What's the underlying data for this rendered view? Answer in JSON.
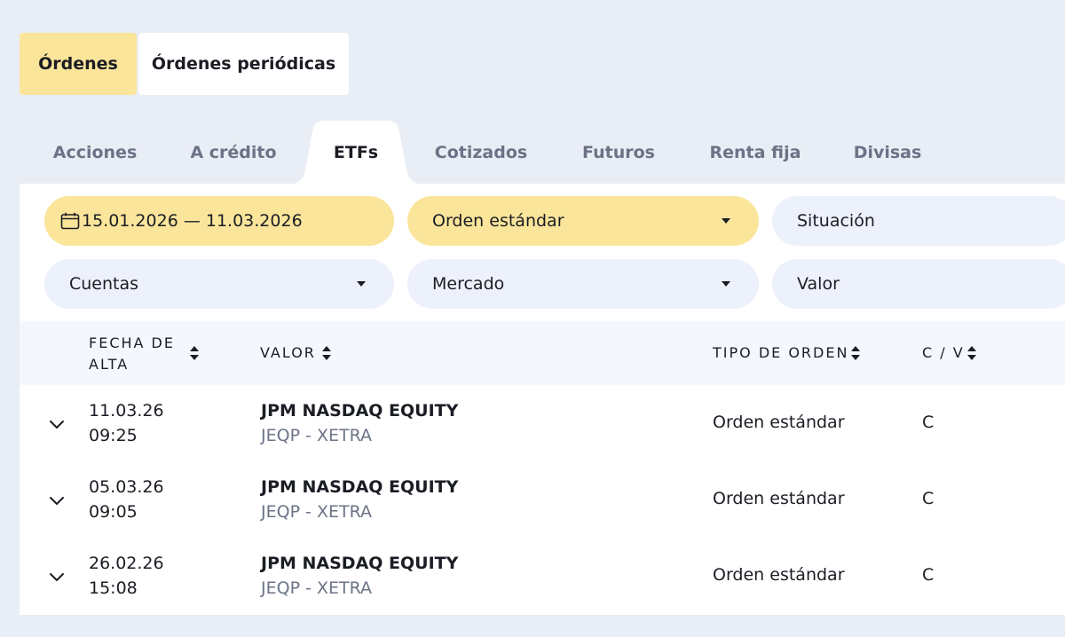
{
  "top_tabs": [
    {
      "label": "Órdenes",
      "active": true
    },
    {
      "label": "Órdenes periódicas",
      "active": false
    }
  ],
  "category_tabs": [
    {
      "label": "Acciones"
    },
    {
      "label": "A crédito"
    },
    {
      "label": "ETFs",
      "active": true
    },
    {
      "label": "Cotizados"
    },
    {
      "label": "Futuros"
    },
    {
      "label": "Renta fija"
    },
    {
      "label": "Divisas"
    }
  ],
  "filters": {
    "date_range": "15.01.2026 — 11.03.2026",
    "order_type": "Orden estándar",
    "status": "Situación",
    "accounts": "Cuentas",
    "market": "Mercado",
    "security": "Valor"
  },
  "table": {
    "headers": {
      "date_line1": "FECHA DE",
      "date_line2": "ALTA",
      "security": "VALOR",
      "order_type": "TIPO DE ORDEN",
      "buy_sell": "C / V"
    },
    "rows": [
      {
        "date": "11.03.26",
        "time": "09:25",
        "name": "JPM NASDAQ EQUITY",
        "sub": "JEQP - XETRA",
        "order_type": "Orden estándar",
        "cv": "C"
      },
      {
        "date": "05.03.26",
        "time": "09:05",
        "name": "JPM NASDAQ EQUITY",
        "sub": "JEQP - XETRA",
        "order_type": "Orden estándar",
        "cv": "C"
      },
      {
        "date": "26.02.26",
        "time": "15:08",
        "name": "JPM NASDAQ EQUITY",
        "sub": "JEQP - XETRA",
        "order_type": "Orden estándar",
        "cv": "C"
      }
    ]
  },
  "colors": {
    "background": "#e9edf5",
    "accent_yellow": "#fbe59b",
    "pill_blue": "#edf1fb",
    "muted_text": "#6b7386"
  }
}
